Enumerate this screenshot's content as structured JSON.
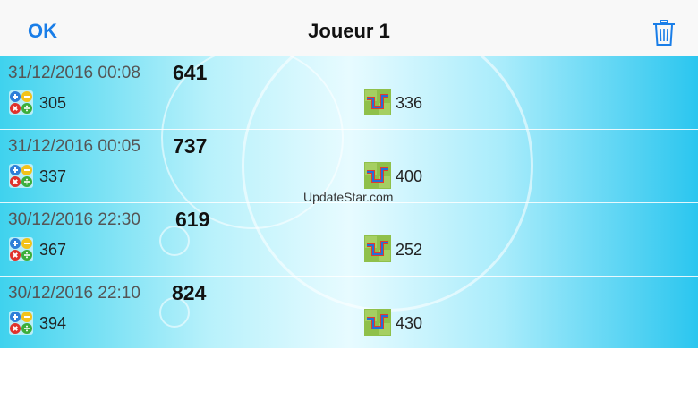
{
  "navbar": {
    "ok_label": "OK",
    "title": "Joueur 1",
    "delete_icon": "trash-icon",
    "accent_color": "#1a7ee8"
  },
  "entries": [
    {
      "date": "31/12/2016 00:08",
      "total": "641",
      "ops_score": "305",
      "pipes_score": "336"
    },
    {
      "date": "31/12/2016 00:05",
      "total": "737",
      "ops_score": "337",
      "pipes_score": "400"
    },
    {
      "date": "30/12/2016 22:30",
      "total": "619",
      "ops_score": "367",
      "pipes_score": "252"
    },
    {
      "date": "30/12/2016 22:10",
      "total": "824",
      "ops_score": "394",
      "pipes_score": "430"
    }
  ],
  "icons": {
    "ops": "math-operators-icon",
    "pipes": "pipe-puzzle-icon"
  },
  "watermark": "UpdateStar.com"
}
